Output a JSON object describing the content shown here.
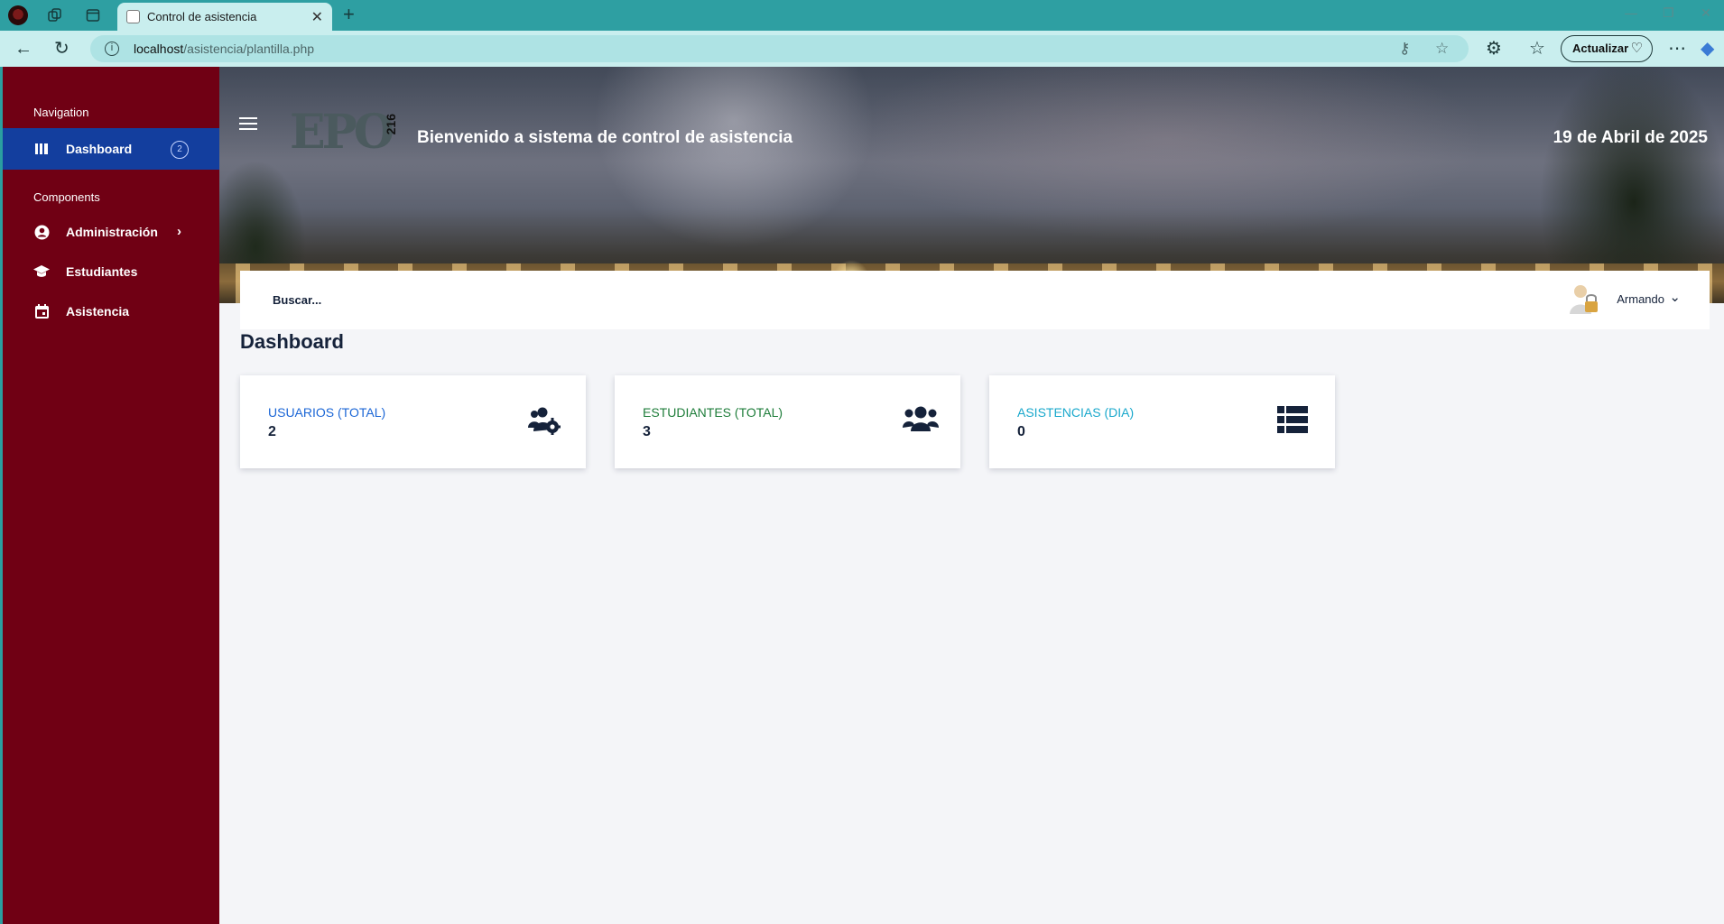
{
  "browser": {
    "tab_title": "Control de asistencia",
    "url_host": "localhost",
    "url_path": "/asistencia/plantilla.php",
    "update_label": "Actualizar",
    "new_tab_glyph": "+",
    "tab_close_glyph": "✕"
  },
  "sidebar": {
    "section_navigation": "Navigation",
    "dashboard": {
      "label": "Dashboard",
      "badge": "2"
    },
    "section_components": "Components",
    "items": [
      {
        "label": "Administración",
        "icon": "user-circle-icon"
      },
      {
        "label": "Estudiantes",
        "icon": "graduation-cap-icon"
      },
      {
        "label": "Asistencia",
        "icon": "calendar-icon"
      }
    ]
  },
  "header": {
    "logo_text": "EPO",
    "logo_number": "216",
    "welcome": "Bienvenido a sistema de control de asistencia",
    "date": "19 de Abril de 2025"
  },
  "searchbar": {
    "search_label": "Buscar...",
    "user_name": "Armando"
  },
  "main": {
    "title": "Dashboard",
    "cards": [
      {
        "label": "USUARIOS (TOTAL)",
        "value": "2",
        "color": "#1b66d6",
        "icon": "users-cog-icon"
      },
      {
        "label": "ESTUDIANTES (TOTAL)",
        "value": "3",
        "color": "#1e7d3a",
        "icon": "users-icon"
      },
      {
        "label": "ASISTENCIAS (DIA)",
        "value": "0",
        "color": "#19a8cc",
        "icon": "list-icon"
      }
    ]
  },
  "colors": {
    "sidebar_bg": "#700014",
    "sidebar_active": "#133e9e",
    "chrome_tabbar": "#2e9fa2",
    "chrome_toolbar": "#c9eeee",
    "text_dark": "#15223a"
  }
}
